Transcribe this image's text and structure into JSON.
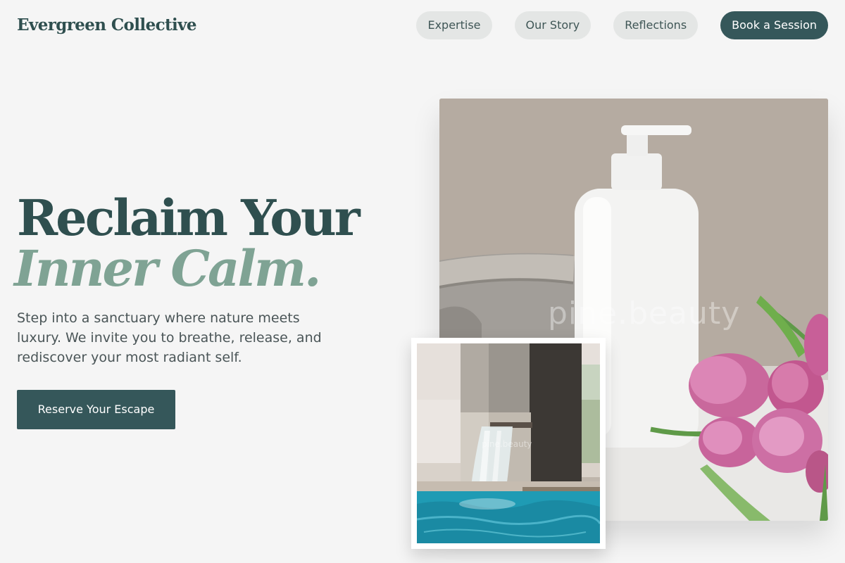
{
  "brand": {
    "name": "Evergreen Collective"
  },
  "nav": {
    "items": [
      "Expertise",
      "Our Story",
      "Reflections"
    ],
    "cta": "Book a Session"
  },
  "hero": {
    "title_line1": "Reclaim Your",
    "title_line2": "Inner Calm.",
    "subtitle": "Step into a sanctuary where nature meets luxury. We invite you to breathe, release, and rediscover your most radiant self.",
    "button": "Reserve Your Escape"
  },
  "images": {
    "main_watermark": "pine.beauty",
    "inset_watermark": "pine.beauty"
  },
  "colors": {
    "primary": "#35575a",
    "heading": "#2f4f4f",
    "accent": "#7fa394",
    "background": "#f5f5f5",
    "pill": "#e4e6e5"
  }
}
